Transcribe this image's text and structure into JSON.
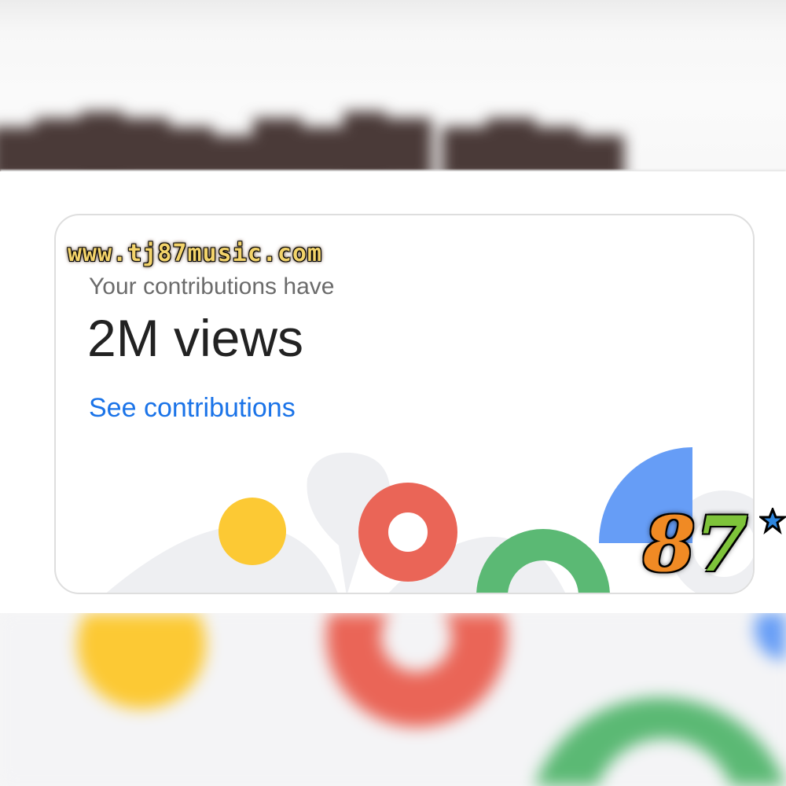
{
  "card": {
    "subtitle": "Your contributions have",
    "value": "2M views",
    "link_label": "See contributions"
  },
  "watermark": {
    "url": "www.tj87music.com",
    "logo_digit_1": "8",
    "logo_digit_2": "7"
  },
  "colors": {
    "yellow": "#fcc934",
    "red": "#ea6557",
    "green": "#5bb974",
    "blue": "#669df6",
    "link": "#1a73e8",
    "shape_gray": "#eeeff2"
  },
  "icons": {
    "logo_star": "star-icon"
  }
}
